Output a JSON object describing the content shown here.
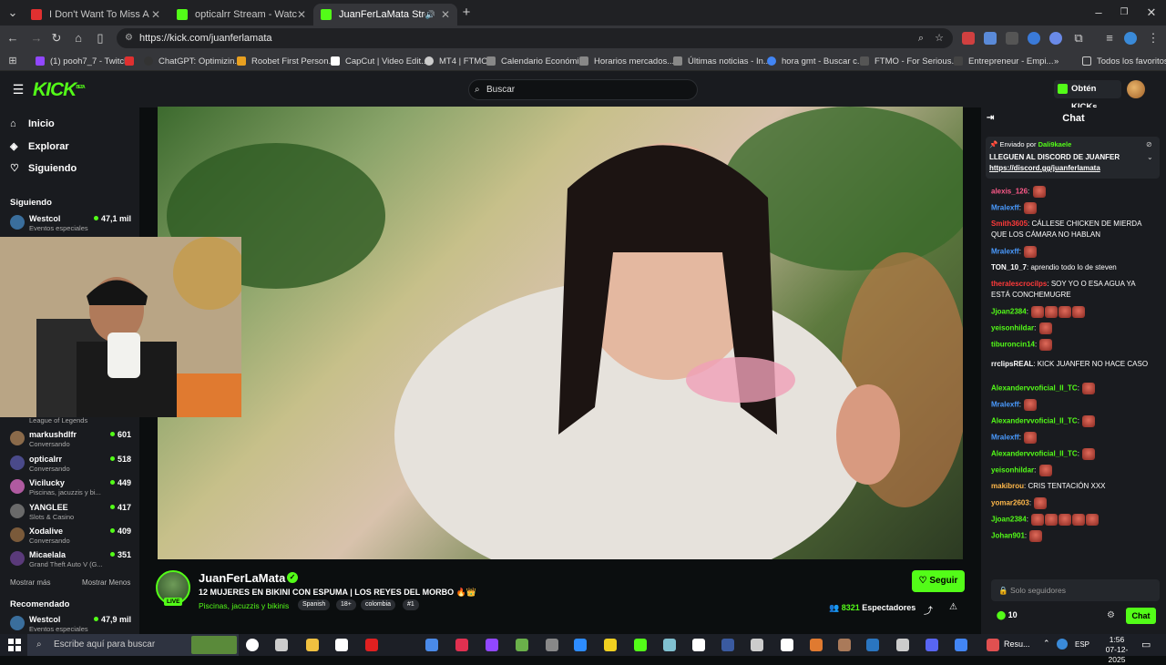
{
  "browser": {
    "tabs": [
      {
        "title": "I Don't Want To Miss A Thing -",
        "favicon_color": "#e03030",
        "active": false
      },
      {
        "title": "opticalrr Stream - Watch Live o",
        "favicon_color": "#53fc18",
        "active": false
      },
      {
        "title": "JuanFerLaMata Stream - W",
        "favicon_color": "#53fc18",
        "active": true
      }
    ],
    "new_tab_label": "+",
    "url": "https://kick.com/juanferlamata",
    "bookmarks": [
      {
        "label": "(1) pooh7_7 - Twitch",
        "color": "#9147ff"
      },
      {
        "label": "ChatGPT: Optimizin...",
        "color": "#333333"
      },
      {
        "label": "Roobet First Person...",
        "color": "#e8a020"
      },
      {
        "label": "CapCut | Video Edit...",
        "color": "#ffffff"
      },
      {
        "label": "MT4 | FTMO",
        "color": "#cccccc"
      },
      {
        "label": "Calendario Económi...",
        "color": "#888888"
      },
      {
        "label": "Horarios mercados...",
        "color": "#888888"
      },
      {
        "label": "Últimas noticias - In...",
        "color": "#888888"
      },
      {
        "label": "hora gmt - Buscar c...",
        "color": "#4285f4"
      },
      {
        "label": "FTMO - For Serious...",
        "color": "#555555"
      },
      {
        "label": "Entrepreneur - Empi...",
        "color": "#444444"
      }
    ],
    "all_favorites": "Todos los favoritos"
  },
  "kick": {
    "logo": "KICK",
    "logo_badge": "BETA",
    "search_placeholder": "Buscar",
    "get_kicks": "Obtén KICKs",
    "accent": "#53fc18"
  },
  "sidebar": {
    "nav": [
      {
        "label": "Inicio",
        "icon": "home-icon"
      },
      {
        "label": "Explorar",
        "icon": "compass-icon"
      },
      {
        "label": "Siguiendo",
        "icon": "heart-icon"
      }
    ],
    "following_title": "Siguiendo",
    "following": [
      {
        "name": "Westcol",
        "category": "Eventos especiales",
        "viewers": "47,1 mil",
        "color": "#3a6e9c"
      },
      {
        "name": "",
        "category": "League of Legends",
        "viewers": "",
        "color": "#555555"
      },
      {
        "name": "markushdlfr",
        "category": "Conversando",
        "viewers": "601",
        "color": "#8a6a4a"
      },
      {
        "name": "opticalrr",
        "category": "Conversando",
        "viewers": "518",
        "color": "#4a4a8a"
      },
      {
        "name": "Vicilucky",
        "category": "Piscinas, jacuzzis y bi...",
        "viewers": "449",
        "color": "#b05aa0"
      },
      {
        "name": "YANGLEE",
        "category": "Slots & Casino",
        "viewers": "417",
        "color": "#6a6a6a"
      },
      {
        "name": "Xodalive",
        "category": "Conversando",
        "viewers": "409",
        "color": "#7a5a3a"
      },
      {
        "name": "Micaelala",
        "category": "Grand Theft Auto V (G...",
        "viewers": "351",
        "color": "#5a3a7a"
      }
    ],
    "show_more": "Mostrar más",
    "show_less": "Mostrar Menos",
    "recommended_title": "Recomendado",
    "recommended": [
      {
        "name": "Westcol",
        "category": "Eventos especiales",
        "viewers": "47,9 mil",
        "color": "#3a6e9c"
      }
    ]
  },
  "stream": {
    "streamer": "JuanFerLaMata",
    "live": "LIVE",
    "title": "12 MUJERES EN BIKINI CON ESPUMA | LOS REYES DEL MORBO 🔥👑",
    "category": "Piscinas, jacuzzis y bikinis",
    "tags": [
      "Spanish",
      "18+",
      "colombia",
      "#1"
    ],
    "follow": "Seguir",
    "viewers": "8321",
    "viewers_label": "Espectadores"
  },
  "chat": {
    "title": "Chat",
    "pinned": {
      "by_label": "Enviado por",
      "by_user": "Dali9kaele",
      "text": "LLEGUEN AL DISCORD DE JUANFER",
      "link": "https://discord.gg/juanferlamata"
    },
    "messages": [
      {
        "user": "alexis_126",
        "text": "",
        "color": "#ff5a8a",
        "emotes": 1
      },
      {
        "user": "Mralexff",
        "text": "",
        "color": "#4a9bff",
        "emotes": 1
      },
      {
        "user": "Smith3605",
        "text": "CÁLLESE CHICKEN DE MIERDA QUE LOS CÁMARA NO HABLAN",
        "color": "#ff3a3a",
        "emotes": 0
      },
      {
        "user": "Mralexff",
        "text": "",
        "color": "#4a9bff",
        "emotes": 1
      },
      {
        "user": "TON_10_7",
        "text": "aprendio todo lo de steven",
        "color": "#ffffff",
        "emotes": 0
      },
      {
        "user": "theralescrocilps",
        "text": "SOY YO O ESA AGUA YA ESTÁ CONCHEMUGRE",
        "color": "#ff3a3a",
        "emotes": 0
      },
      {
        "user": "Jjoan2384",
        "text": "",
        "color": "#53fc18",
        "emotes": 4
      },
      {
        "user": "yeisonhildar",
        "text": "",
        "color": "#53fc18",
        "emotes": 1
      },
      {
        "user": "tiburoncin14",
        "text": "",
        "color": "#53fc18",
        "emotes": 1
      },
      {
        "user": "rrclipsREAL",
        "text": "KICK JUANFER NO HACE CASO",
        "color": "#ffffff",
        "emotes": 0
      },
      {
        "user": "Alexandervvoficial_II_TC",
        "text": "",
        "color": "#53fc18",
        "emotes": 1
      },
      {
        "user": "Mralexff",
        "text": "",
        "color": "#4a9bff",
        "emotes": 1
      },
      {
        "user": "Alexandervvoficial_II_TC",
        "text": "",
        "color": "#53fc18",
        "emotes": 1
      },
      {
        "user": "Mralexff",
        "text": "",
        "color": "#4a9bff",
        "emotes": 1
      },
      {
        "user": "Alexandervvoficial_II_TC",
        "text": "",
        "color": "#53fc18",
        "emotes": 1
      },
      {
        "user": "yeisonhildar",
        "text": "",
        "color": "#53fc18",
        "emotes": 1
      },
      {
        "user": "makibrou",
        "text": "CRIS TENTACIÓN XXX",
        "color": "#ffb84a",
        "emotes": 0
      },
      {
        "user": "yomar2603",
        "text": "",
        "color": "#ffb84a",
        "emotes": 1
      },
      {
        "user": "Jjoan2384",
        "text": "",
        "color": "#53fc18",
        "emotes": 5
      },
      {
        "user": "Johan901",
        "text": "",
        "color": "#53fc18",
        "emotes": 1
      }
    ],
    "input_placeholder": "Solo seguidores",
    "points": "10",
    "send": "Chat"
  },
  "taskbar": {
    "search_placeholder": "Escribe aquí para buscar",
    "running_label": "Resu...",
    "language": "ESP",
    "time": "1:56",
    "date": "07-12-2025"
  }
}
